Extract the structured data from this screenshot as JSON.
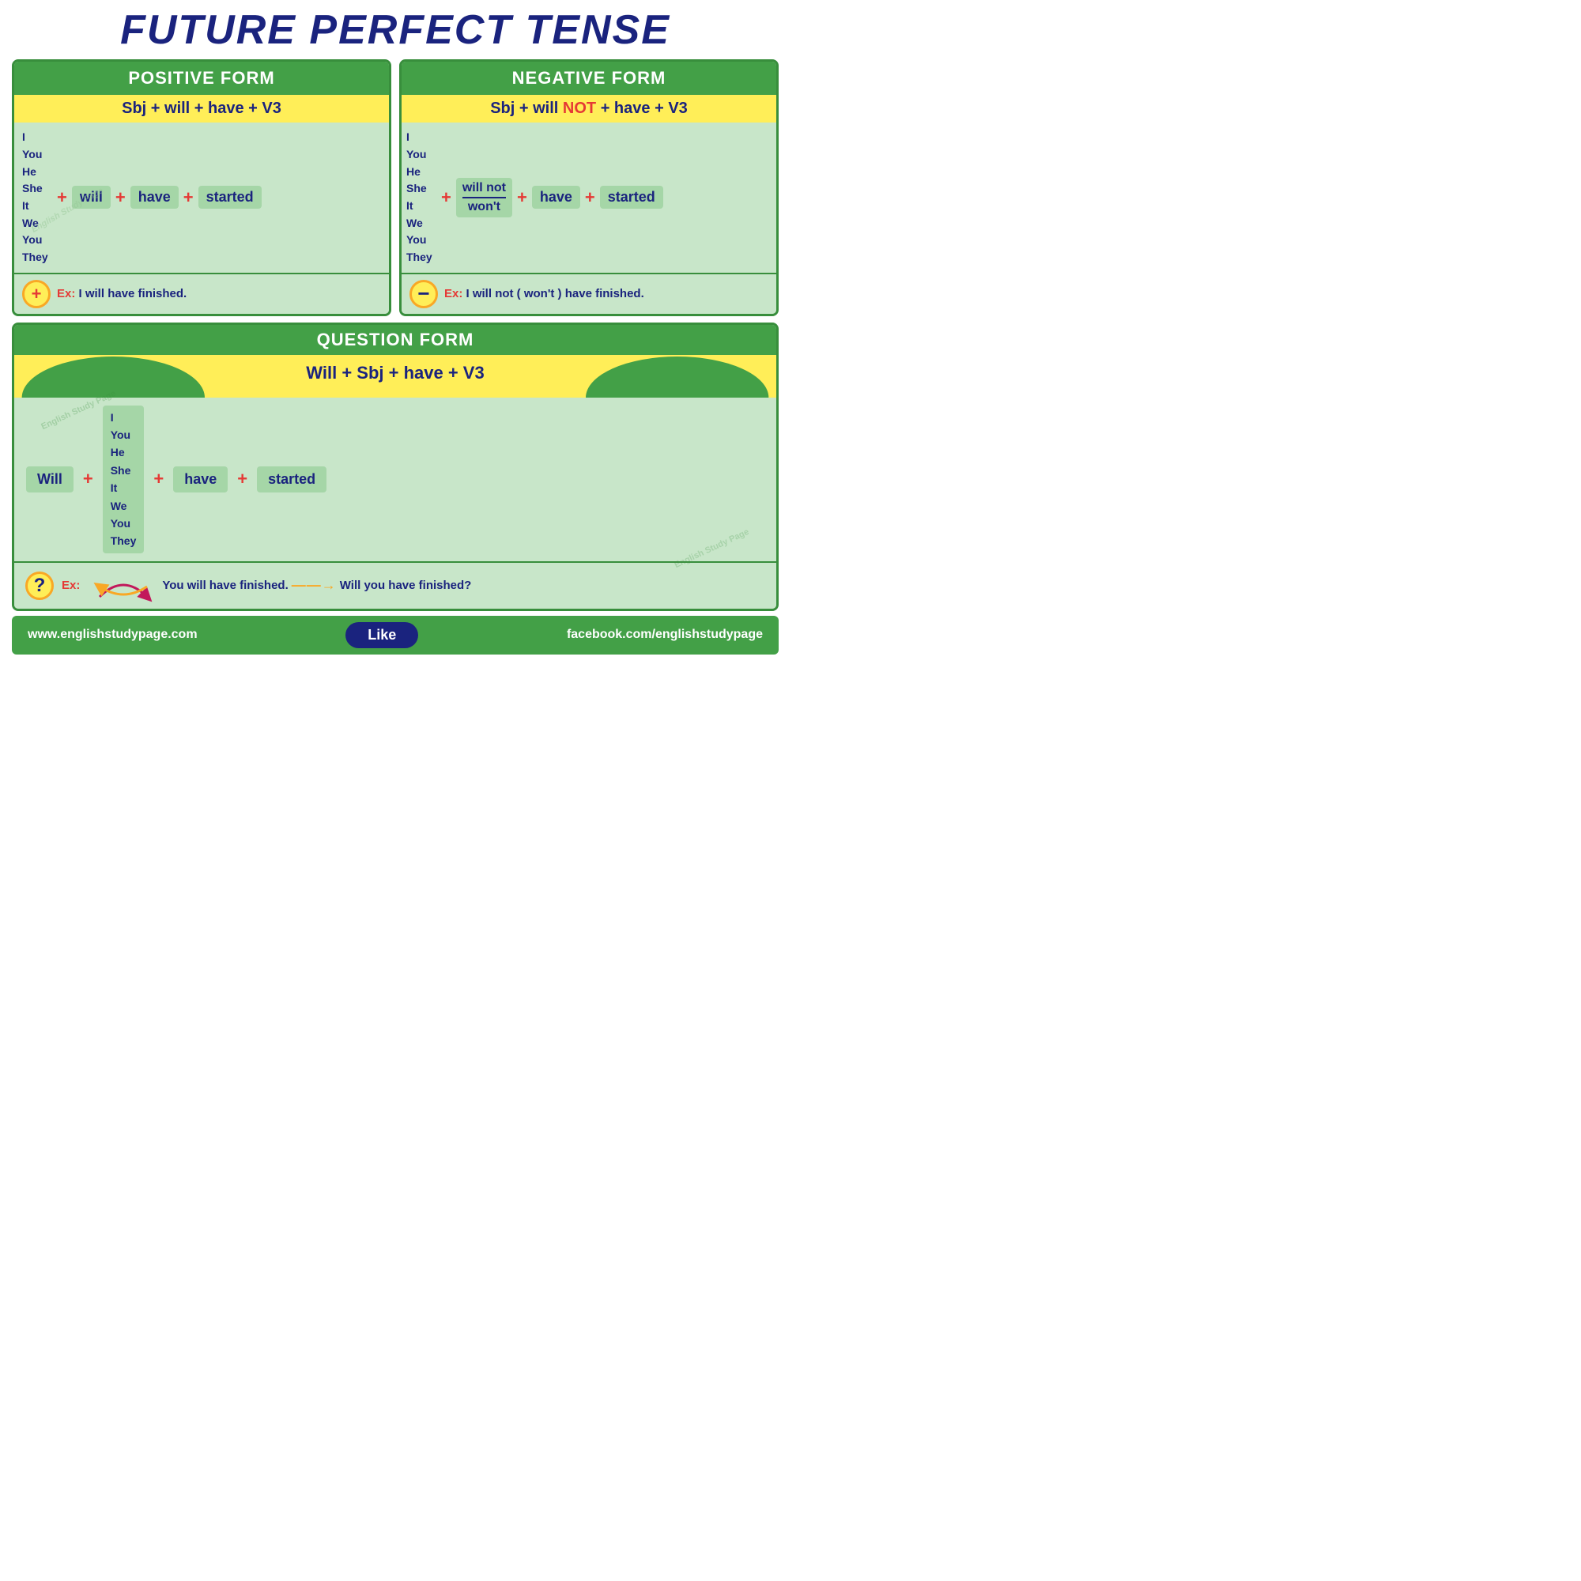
{
  "title": "FUTURE PERFECT TENSE",
  "positive": {
    "header": "POSITIVE FORM",
    "formula": "Sbj + will + have + V3",
    "pronouns": "I\nYou\nHe\nShe\nIt\nWe\nYou\nThey",
    "plus": "+",
    "will": "will",
    "have": "have",
    "started": "started",
    "example_label": "Ex:",
    "example": "I will have finished."
  },
  "negative": {
    "header": "NEGATIVE FORM",
    "formula_start": "Sbj + will ",
    "formula_not": "NOT",
    "formula_end": " + have + V3",
    "pronouns": "I\nYou\nHe\nShe\nIt\nWe\nYou\nThey",
    "plus": "+",
    "will_not": "will not",
    "wont": "won't",
    "have": "have",
    "started": "started",
    "example_label": "Ex:",
    "example": "I will not ( won't ) have finished."
  },
  "question": {
    "header": "QUESTION FORM",
    "formula": "Will +  Sbj + have + V3",
    "will": "Will",
    "pronouns": "I\nYou\nHe\nShe\nIt\nWe\nYou\nThey",
    "have": "have",
    "started": "started",
    "example_label": "Ex:",
    "example_you": "You",
    "example_will": "will",
    "example_rest": "have finished.",
    "arrow_label": "——→",
    "answer": "Will you have finished?"
  },
  "footer": {
    "left": "www.englishstudypage.com",
    "like": "Like",
    "right": "facebook.com/englishstudypage"
  },
  "watermark": "English Study Page"
}
